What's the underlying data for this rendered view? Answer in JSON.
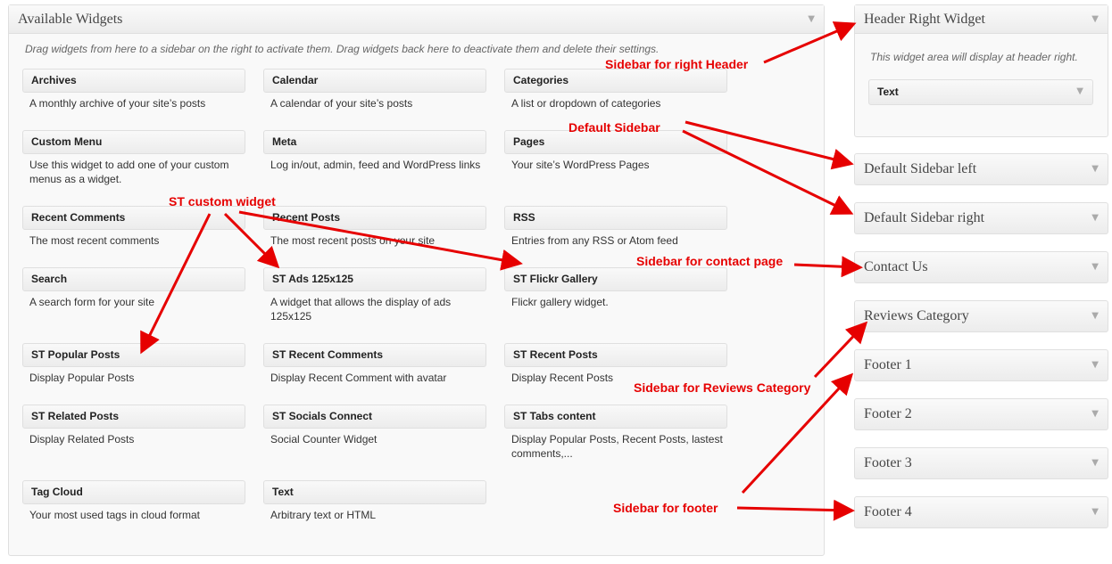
{
  "available": {
    "title": "Available Widgets",
    "hint": "Drag widgets from here to a sidebar on the right to activate them. Drag widgets back here to deactivate them and delete their settings.",
    "widgets": [
      {
        "title": "Archives",
        "desc": "A monthly archive of your site’s posts"
      },
      {
        "title": "Calendar",
        "desc": "A calendar of your site’s posts"
      },
      {
        "title": "Categories",
        "desc": "A list or dropdown of categories"
      },
      {
        "title": "Custom Menu",
        "desc": "Use this widget to add one of your custom menus as a widget."
      },
      {
        "title": "Meta",
        "desc": "Log in/out, admin, feed and WordPress links"
      },
      {
        "title": "Pages",
        "desc": "Your site’s WordPress Pages"
      },
      {
        "title": "Recent Comments",
        "desc": "The most recent comments"
      },
      {
        "title": "Recent Posts",
        "desc": "The most recent posts on your site"
      },
      {
        "title": "RSS",
        "desc": "Entries from any RSS or Atom feed"
      },
      {
        "title": "Search",
        "desc": "A search form for your site"
      },
      {
        "title": "ST Ads 125x125",
        "desc": "A widget that allows the display of ads 125x125"
      },
      {
        "title": "ST Flickr Gallery",
        "desc": "Flickr gallery widget."
      },
      {
        "title": "ST Popular Posts",
        "desc": "Display Popular Posts"
      },
      {
        "title": "ST Recent Comments",
        "desc": "Display Recent Comment with avatar"
      },
      {
        "title": "ST Recent Posts",
        "desc": "Display Recent Posts"
      },
      {
        "title": "ST Related Posts",
        "desc": "Display Related Posts"
      },
      {
        "title": "ST Socials Connect",
        "desc": "Social Counter Widget"
      },
      {
        "title": "ST Tabs content",
        "desc": "Display Popular Posts, Recent Posts, lastest comments,..."
      },
      {
        "title": "Tag Cloud",
        "desc": "Your most used tags in cloud format"
      },
      {
        "title": "Text",
        "desc": "Arbitrary text or HTML"
      }
    ]
  },
  "header_right": {
    "title": "Header Right Widget",
    "desc": "This widget area will display at header right.",
    "widget": "Text"
  },
  "sidebars": [
    "Default Sidebar left",
    "Default Sidebar right",
    "Contact Us",
    "Reviews Category",
    "Footer 1",
    "Footer 2",
    "Footer 3",
    "Footer 4"
  ],
  "annotations": {
    "right_header": "Sidebar for right Header",
    "default": "Default Sidebar",
    "custom": "ST custom widget",
    "contact": "Sidebar for contact page",
    "reviews": "Sidebar for Reviews Category",
    "footer": "Sidebar for footer"
  },
  "colors": {
    "annotation": "#e60000"
  }
}
